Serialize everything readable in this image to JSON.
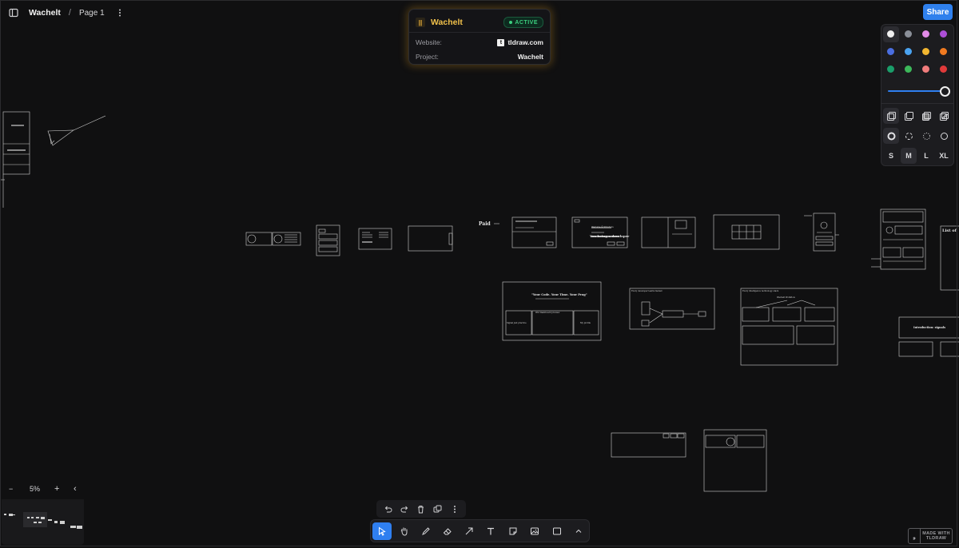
{
  "topbar": {
    "doc_title": "Wachelt",
    "separator": "/",
    "page_name": "Page 1",
    "share_label": "Share"
  },
  "project_card": {
    "logo_glyph": "||",
    "name": "Wachelt",
    "status": "ACTIVE",
    "website_label": "Website:",
    "website_icon_glyph": "t",
    "website_value": "tldraw.com",
    "project_label": "Project:",
    "project_value": "Wachelt"
  },
  "style_panel": {
    "colors": [
      "#f0f0f0",
      "#8a8f98",
      "#e28be8",
      "#ad4fd8",
      "#4a6ee0",
      "#4aa3f0",
      "#f2b630",
      "#f07a20",
      "#1a9e6a",
      "#3cb85a",
      "#f07c7c",
      "#e03a3a"
    ],
    "selected_color": "#f0f0f0",
    "opacity": 1.0,
    "sizes": [
      "S",
      "M",
      "L",
      "XL"
    ],
    "selected_size": "M"
  },
  "canvas": {
    "paid_label": "Paid",
    "list_label": "List of",
    "tagline": "\"Your Code. Your Time. Your Prog\"",
    "intro_label": "Introduction: signals"
  },
  "zoom": {
    "out_glyph": "−",
    "level": "5%",
    "in_glyph": "+",
    "collapse_glyph": "‹"
  },
  "toolbar": {
    "selected": "select",
    "tools": [
      "select",
      "hand",
      "draw",
      "eraser",
      "arrow",
      "text",
      "note",
      "media",
      "rectangle",
      "more"
    ]
  },
  "actions": [
    "undo",
    "redo",
    "delete",
    "duplicate",
    "more"
  ],
  "made_with": {
    "line1": "MADE WITH",
    "line2": "TLDRAW"
  }
}
